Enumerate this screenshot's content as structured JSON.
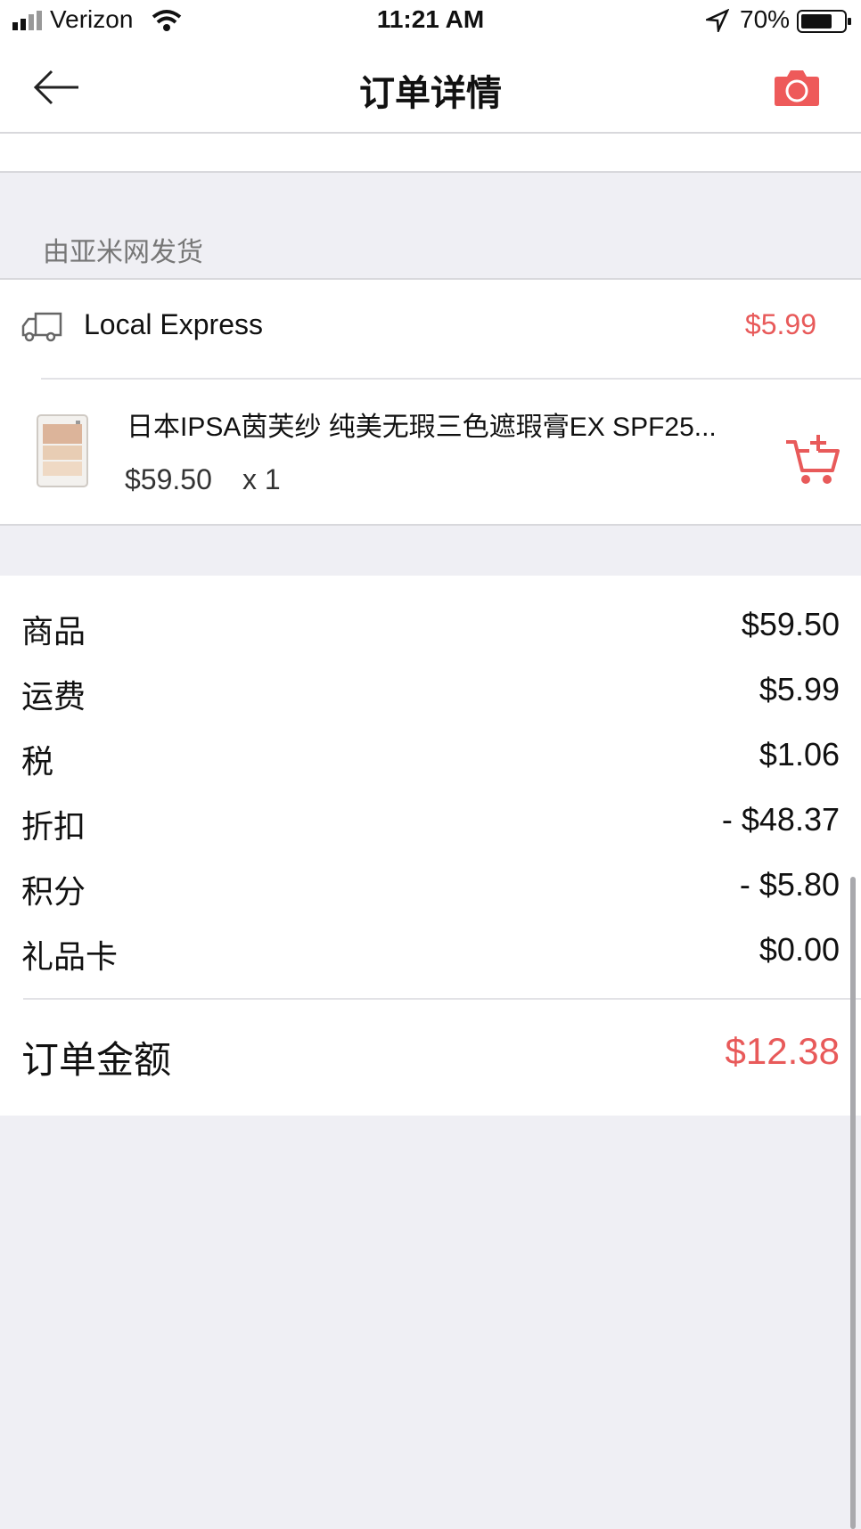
{
  "status_bar": {
    "carrier": "Verizon",
    "time": "11:21 AM",
    "battery": "70%"
  },
  "header": {
    "title": "订单详情"
  },
  "section": {
    "label": "由亚米网发货"
  },
  "shipping": {
    "method": "Local Express",
    "price": "$5.99"
  },
  "product": {
    "name": "日本IPSA茵芙纱 纯美无瑕三色遮瑕膏EX SPF25...",
    "price": "$59.50",
    "quantity": "x 1"
  },
  "summary": {
    "rows": [
      {
        "label": "商品",
        "value": "$59.50"
      },
      {
        "label": "运费",
        "value": "$5.99"
      },
      {
        "label": "税",
        "value": "$1.06"
      },
      {
        "label": "折扣",
        "value": "- $48.37"
      },
      {
        "label": "积分",
        "value": "- $5.80"
      },
      {
        "label": "礼品卡",
        "value": "$0.00"
      }
    ],
    "total_label": "订单金额",
    "total_value": "$12.38"
  },
  "colors": {
    "accent": "#e85a5a",
    "background": "#efeff4"
  }
}
